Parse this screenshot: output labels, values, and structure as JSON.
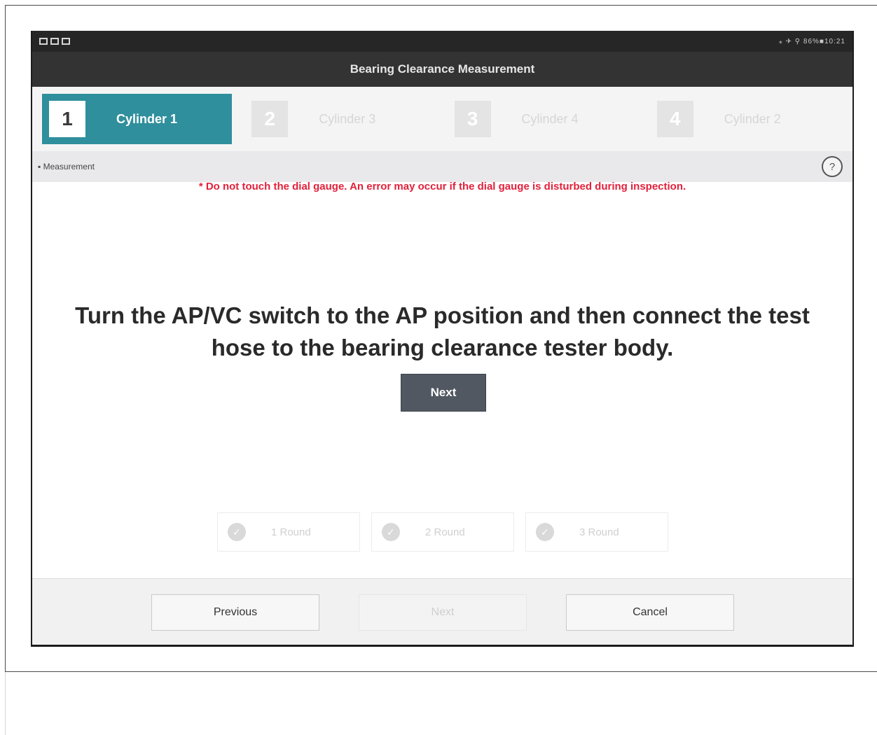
{
  "status_bar": {
    "left_icons": [
      "screen-icon",
      "sim-icon",
      "image-icon"
    ],
    "right_text": "⁎ ✈ ⚲ 86%■10:21"
  },
  "header": {
    "title": "Bearing Clearance Measurement"
  },
  "steps": [
    {
      "number": "1",
      "label": "Cylinder 1",
      "active": true
    },
    {
      "number": "2",
      "label": "Cylinder 3",
      "active": false
    },
    {
      "number": "3",
      "label": "Cylinder 4",
      "active": false
    },
    {
      "number": "4",
      "label": "Cylinder 2",
      "active": false
    }
  ],
  "section": {
    "label": "▪ Measurement",
    "help_icon": "?"
  },
  "warning": "* Do not touch the dial gauge. An error may occur if the dial gauge is disturbed during inspection.",
  "instruction": {
    "line1": "Turn the AP/VC switch to the AP position and then connect the test",
    "line2": "hose to the bearing clearance tester body."
  },
  "next_button": "Next",
  "rounds": [
    "1 Round",
    "2 Round",
    "3 Round"
  ],
  "footer": {
    "previous": "Previous",
    "next": "Next",
    "cancel": "Cancel"
  },
  "colors": {
    "accent": "#2f8f9c",
    "warning": "#e2213b",
    "title_bar": "#333333"
  }
}
